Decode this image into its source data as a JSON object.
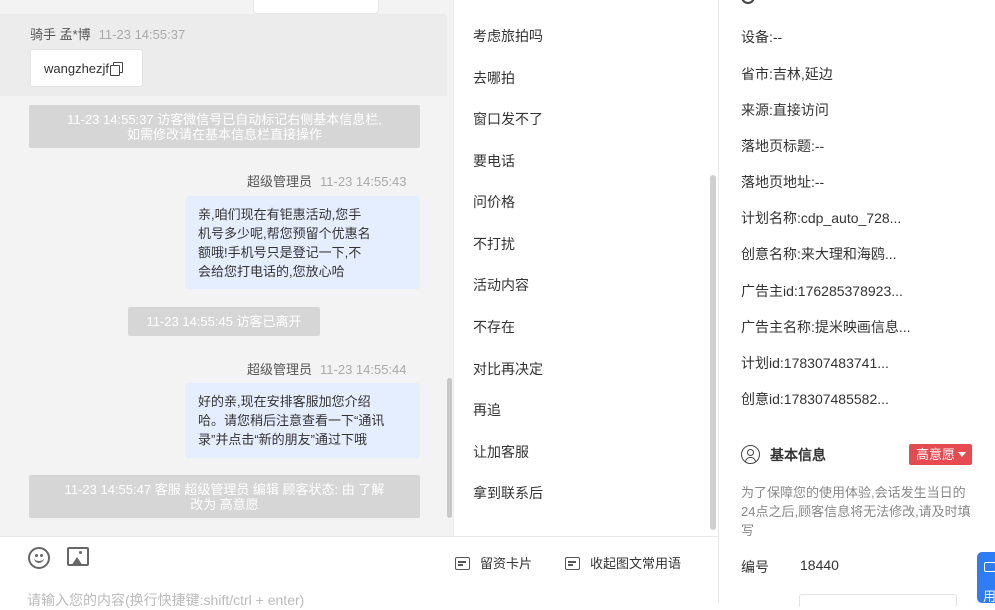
{
  "chat": {
    "visitor": {
      "name": "骑手 孟*博",
      "time": "11-23 14:55:37"
    },
    "wechat_card": {
      "text": "wangzhezjf"
    },
    "system_notice_1": {
      "line1": "11-23 14:55:37 访客微信号已自动标记右侧基本信息栏,",
      "line2": "如需修改请在基本信息栏直接操作"
    },
    "agent_msg_1": {
      "sender": "超级管理员",
      "time": "11-23 14:55:43",
      "lines": [
        "亲,咱们现在有钜惠活动,您手",
        "机号多少呢,帮您预留个优惠名",
        "额哦!手机号只是登记一下,不",
        "会给您打电话的,您放心哈"
      ]
    },
    "left_notice": "11-23 14:55:45 访客已离开",
    "agent_msg_2": {
      "sender": "超级管理员",
      "time": "11-23 14:55:44",
      "lines": [
        "好的亲,现在安排客服加您介绍",
        "哈。请您稍后注意查看一下“通讯",
        "录”并点击“新的朋友”通过下哦"
      ]
    },
    "system_notice_2": {
      "line1": "11-23 14:55:47 客服 超级管理员 编辑 顾客状态: 由 了解",
      "line2": "改为 高意愿"
    }
  },
  "quick_replies": [
    "考虑旅拍吗",
    "去哪拍",
    "窗口发不了",
    "要电话",
    "问价格",
    "不打扰",
    "活动内容",
    "不存在",
    "对比再决定",
    "再追",
    "让加客服",
    "拿到联系后"
  ],
  "toolbar": {
    "emoji_icon": "emoji-icon",
    "image_icon": "image-icon",
    "card_label": "留资卡片",
    "collapse_label": "收起图文常用语",
    "input_placeholder": "请输入您的内容(换行快捷键:shift/ctrl + enter)"
  },
  "info": {
    "rows": [
      {
        "label": "设备:",
        "value": "--"
      },
      {
        "label": "省市:",
        "value": "吉林,延边"
      },
      {
        "label": "来源:",
        "value": "直接访问"
      },
      {
        "label": "落地页标题:",
        "value": "--"
      },
      {
        "label": "落地页地址:",
        "value": "--"
      },
      {
        "label": "计划名称:",
        "value": "cdp_auto_728..."
      },
      {
        "label": "创意名称:",
        "value": "来大理和海鸥..."
      },
      {
        "label": "广告主id:",
        "value": "176285378923..."
      },
      {
        "label": "广告主名称:",
        "value": "提米映画信息..."
      },
      {
        "label": "计划id:",
        "value": "178307483741..."
      },
      {
        "label": "创意id:",
        "value": "178307485582..."
      }
    ],
    "basic_title": "基本信息",
    "intent_badge": "高意愿",
    "notice": "为了保障您的使用体验,会话发生当日的24点之后,顾客信息将无法修改,请及时填写",
    "id_label": "编号",
    "id_value": "18440",
    "float_label": "用"
  },
  "colors": {
    "accent": "#2e7cf6",
    "bubble": "#e4eeff",
    "badge": "#e64b52",
    "system_bar": "#d6d6d6"
  }
}
